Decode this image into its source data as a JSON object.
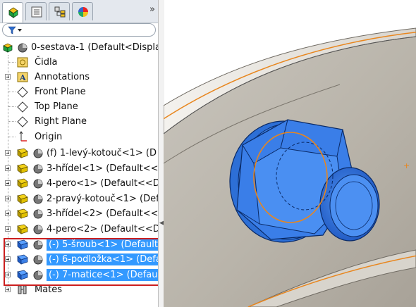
{
  "tabs": [
    {
      "name": "feature-manager",
      "active": true
    },
    {
      "name": "property-manager",
      "active": false
    },
    {
      "name": "configuration-manager",
      "active": false
    },
    {
      "name": "display-manager",
      "active": false
    }
  ],
  "more_glyph": "»",
  "tree": {
    "root": "0-sestava-1  (Default<Displa",
    "items": [
      {
        "label": "Čidla",
        "icon": "sensor-icon"
      },
      {
        "label": "Annotations",
        "icon": "annotations-icon"
      },
      {
        "label": "Front Plane",
        "icon": "plane-icon"
      },
      {
        "label": "Top Plane",
        "icon": "plane-icon"
      },
      {
        "label": "Right Plane",
        "icon": "plane-icon"
      },
      {
        "label": "Origin",
        "icon": "origin-icon"
      }
    ],
    "components": [
      {
        "label": "(f) 1-levý-kotouč<1> (D",
        "selected": false
      },
      {
        "label": "3-hřídel<1> (Default<<D",
        "selected": false
      },
      {
        "label": "4-pero<1> (Default<<D",
        "selected": false
      },
      {
        "label": "2-pravý-kotouč<1> (Def",
        "selected": false
      },
      {
        "label": "3-hřídel<2> (Default<<D",
        "selected": false
      },
      {
        "label": "4-pero<2> (Default<<D",
        "selected": false
      },
      {
        "label": "(-) 5-šroub<1> (Default<",
        "selected": true
      },
      {
        "label": "(-) 6-podložka<1> (Defa",
        "selected": true
      },
      {
        "label": "(-) 7-matice<1> (Defaul",
        "selected": true
      }
    ],
    "mates": "Mates"
  },
  "colors": {
    "selection": "#3399ff",
    "highlight_box": "#cc1f1f",
    "model_blue": "#3d7fe0",
    "sketch_orange": "#e8861e"
  }
}
